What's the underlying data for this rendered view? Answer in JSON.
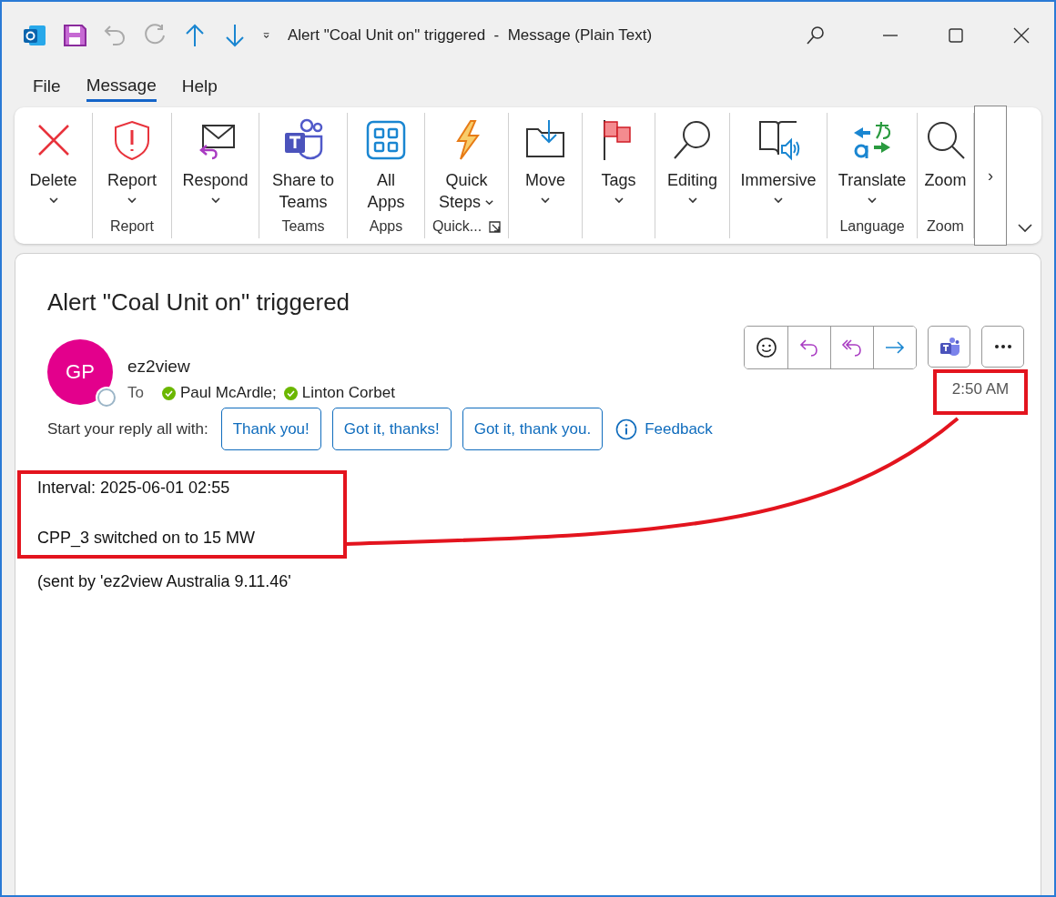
{
  "window": {
    "title": "Alert \"Coal Unit on\" triggered  -  Message (Plain Text)"
  },
  "menu_tabs": [
    {
      "label": "File",
      "selected": false
    },
    {
      "label": "Message",
      "selected": true
    },
    {
      "label": "Help",
      "selected": false
    }
  ],
  "ribbon": {
    "groups": [
      {
        "buttons": [
          {
            "label": "Delete",
            "dropdown": true
          }
        ]
      },
      {
        "label": "Report",
        "buttons": [
          {
            "label": "Report",
            "dropdown": true
          }
        ]
      },
      {
        "buttons": [
          {
            "label": "Respond",
            "dropdown": true
          }
        ]
      },
      {
        "label": "Teams",
        "buttons": [
          {
            "label": "Share to Teams",
            "dropdown": false
          }
        ]
      },
      {
        "label": "Apps",
        "buttons": [
          {
            "label": "All Apps",
            "dropdown": false
          }
        ]
      },
      {
        "label": "Quick...",
        "launcher": true,
        "buttons": [
          {
            "label": "Quick Steps",
            "dropdown": true,
            "caret_inline": true
          }
        ]
      },
      {
        "buttons": [
          {
            "label": "Move",
            "dropdown": true
          }
        ]
      },
      {
        "buttons": [
          {
            "label": "Tags",
            "dropdown": true
          }
        ]
      },
      {
        "buttons": [
          {
            "label": "Editing",
            "dropdown": true
          }
        ]
      },
      {
        "buttons": [
          {
            "label": "Immersive",
            "dropdown": true
          }
        ]
      },
      {
        "label": "Language",
        "buttons": [
          {
            "label": "Translate",
            "dropdown": true
          }
        ]
      },
      {
        "label": "Zoom",
        "buttons": [
          {
            "label": "Zoom",
            "dropdown": false
          }
        ]
      }
    ],
    "scroll_button": "›"
  },
  "message": {
    "subject": "Alert \"Coal Unit on\" triggered",
    "avatar_initials": "GP",
    "sender": "ez2view",
    "to_label": "To",
    "recipients": [
      {
        "name": "Paul McArdle;"
      },
      {
        "name": "Linton Corbet"
      }
    ],
    "time": {
      "text": "2:50 AM",
      "highlighted": true
    },
    "quick_reply_label": "Start your reply all with:",
    "quick_replies": [
      "Thank you!",
      "Got it, thanks!",
      "Got it, thank you."
    ],
    "feedback": "Feedback",
    "body": [
      {
        "highlighted": true,
        "lines": [
          "Interval: 2025-06-01 02:55",
          "CPP_3 switched on to 15 MW"
        ]
      },
      {
        "highlighted": false,
        "lines": [
          "(sent by 'ez2view Australia 9.11.46'"
        ]
      }
    ]
  }
}
